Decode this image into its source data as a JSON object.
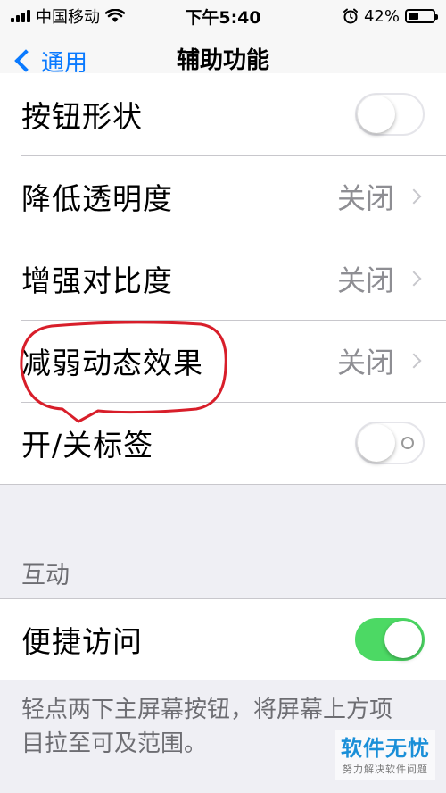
{
  "status_bar": {
    "carrier": "中国移动",
    "time": "下午5:40",
    "battery_percent": "42%",
    "battery_level": 0.42,
    "icons": [
      "signal-bars-icon",
      "wifi-icon",
      "alarm-clock-icon",
      "battery-icon"
    ]
  },
  "nav": {
    "back_label": "通用",
    "title": "辅助功能"
  },
  "settings": {
    "button_shapes": {
      "label": "按钮形状",
      "toggle": "off"
    },
    "reduce_transparency": {
      "label": "降低透明度",
      "value": "关闭"
    },
    "increase_contrast": {
      "label": "增强对比度",
      "value": "关闭"
    },
    "reduce_motion": {
      "label": "减弱动态效果",
      "value": "关闭"
    },
    "on_off_labels": {
      "label": "开/关标签",
      "toggle": "off"
    }
  },
  "interaction": {
    "header": "互动",
    "reachability": {
      "label": "便捷访问",
      "toggle": "on"
    },
    "footer": "轻点两下主屏幕按钮，将屏幕上方项目拉至可及范围。"
  },
  "watermark": {
    "title": "软件无忧",
    "subtitle": "努力解决软件问题"
  },
  "colors": {
    "accent": "#0a7aff",
    "toggle_on": "#4cd964",
    "annotation_red": "#d81e2a",
    "background": "#efeff4"
  }
}
